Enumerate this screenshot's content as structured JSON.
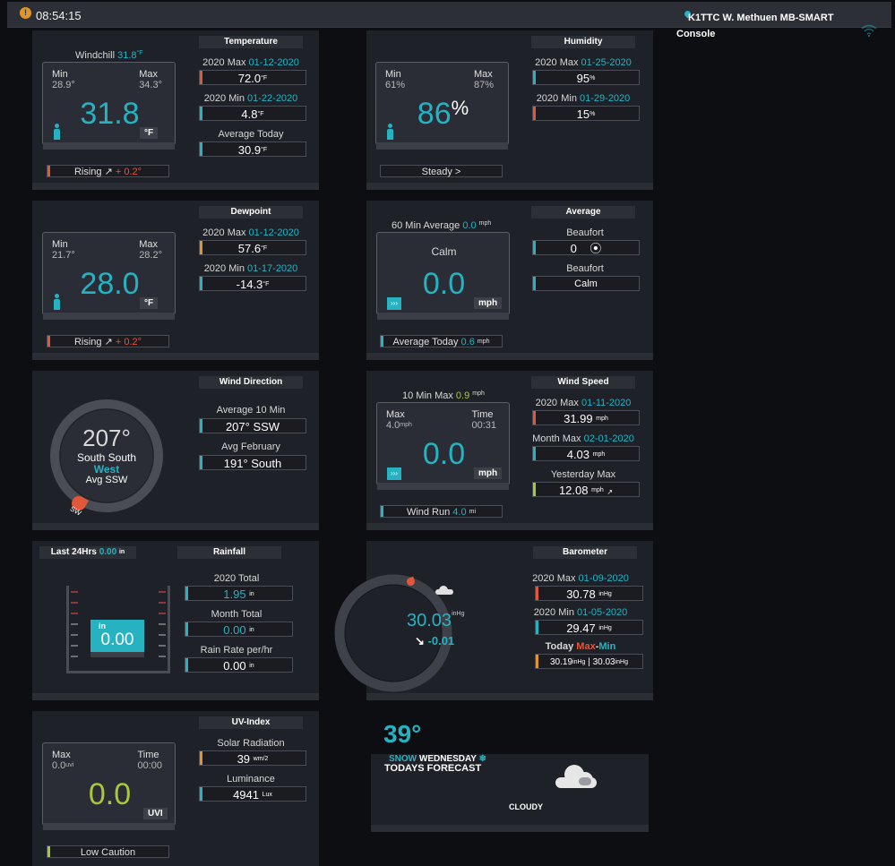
{
  "header": {
    "time": "08:54:15",
    "station": "K1TTC W. Methuen MB-SMART",
    "console": "Console"
  },
  "colors": {
    "accent": "#27b2c2",
    "hot": "#e2563a",
    "warm": "#e0952a",
    "lime": "#a6c83a",
    "panel": "#1f2128"
  },
  "temperature": {
    "title": "Temperature",
    "windchill_label": "Windchill",
    "windchill_value": "31.8",
    "windchill_unit": "°F",
    "min_label": "Min",
    "min_value": "28.9°",
    "max_label": "Max",
    "max_value": "34.3°",
    "current": "31.8",
    "unit": "°F",
    "trend_text": "Rising",
    "trend_delta": "+ 0.2°",
    "year_max_label": "2020 Max",
    "year_max_date": "01-12-2020",
    "year_max_value": "72.0",
    "year_max_unit": "°F",
    "year_min_label": "2020 Min",
    "year_min_date": "01-22-2020",
    "year_min_value": "4.8",
    "year_min_unit": "°F",
    "avg_label": "Average Today",
    "avg_value": "30.9",
    "avg_unit": "°F"
  },
  "humidity": {
    "title": "Humidity",
    "min_label": "Min",
    "min_value": "61%",
    "max_label": "Max",
    "max_value": "87%",
    "current": "86",
    "unit": "%",
    "trend_text": "Steady >",
    "year_max_label": "2020 Max",
    "year_max_date": "01-25-2020",
    "year_max_value": "95",
    "year_max_unit": "%",
    "year_min_label": "2020 Min",
    "year_min_date": "01-29-2020",
    "year_min_value": "15",
    "year_min_unit": "%"
  },
  "dewpoint": {
    "title": "Dewpoint",
    "min_label": "Min",
    "min_value": "21.7°",
    "max_label": "Max",
    "max_value": "28.2°",
    "current": "28.0",
    "unit": "°F",
    "trend_text": "Rising",
    "trend_delta": "+ 0.2°",
    "year_max_label": "2020 Max",
    "year_max_date": "01-12-2020",
    "year_max_value": "57.6",
    "year_max_unit": "°F",
    "year_min_label": "2020 Min",
    "year_min_date": "01-17-2020",
    "year_min_value": "-14.3",
    "year_min_unit": "°F"
  },
  "wind_average": {
    "title": "Average",
    "avg60_label": "60 Min Average",
    "avg60_value": "0.0",
    "avg60_unit": "mph",
    "condition": "Calm",
    "current": "0.0",
    "unit": "mph",
    "avg_today_label": "Average Today",
    "avg_today_value": "0.6",
    "avg_today_unit": "mph",
    "beaufort_label": "Beaufort",
    "beaufort_value": "0",
    "beaufort2_label": "Beaufort",
    "beaufort2_value": "Calm"
  },
  "wind_direction": {
    "title": "Wind Direction",
    "degrees": "207°",
    "line1": "South South",
    "line2": "West",
    "line3": "Avg SSW",
    "marker": "SW",
    "avg10_label": "Average 10 Min",
    "avg10_value": "207°  SSW",
    "avg_month_label": "Avg February",
    "avg_month_value": "191°  South"
  },
  "wind_speed": {
    "title": "Wind Speed",
    "max10_label": "10 Min Max",
    "max10_value": "0.9",
    "max10_unit": "mph",
    "max_label": "Max",
    "max_value": "4.0",
    "max_unit": "mph",
    "time_label": "Time",
    "time_value": "00:31",
    "current": "0.0",
    "unit": "mph",
    "windrun_label": "Wind Run",
    "windrun_value": "4.0",
    "windrun_unit": "mi",
    "year_max_label": "2020 Max",
    "year_max_date": "01-11-2020",
    "year_max_value": "31.99",
    "year_max_unit": "mph",
    "month_max_label": "Month Max",
    "month_max_date": "02-01-2020",
    "month_max_value": "4.03",
    "month_max_unit": "mph",
    "yesterday_label": "Yesterday Max",
    "yesterday_value": "12.08",
    "yesterday_unit": "mph"
  },
  "rainfall": {
    "title": "Rainfall",
    "last24_label": "Last 24Hrs",
    "last24_value": "0.00",
    "last24_unit": "in",
    "gauge_unit": "in",
    "gauge_value": "0.00",
    "year_label": "2020 Total",
    "year_value": "1.95",
    "year_unit": "in",
    "month_label": "Month Total",
    "month_value": "0.00",
    "month_unit": "in",
    "rate_label": "Rain Rate per/hr",
    "rate_value": "0.00",
    "rate_unit": "in"
  },
  "barometer": {
    "title": "Barometer",
    "current": "30.03",
    "unit": "inHg",
    "trend": "-0.01",
    "year_max_label": "2020 Max",
    "year_max_date": "01-09-2020",
    "year_max_value": "30.78",
    "year_max_unit": "inHg",
    "year_min_label": "2020 Min",
    "year_min_date": "01-05-2020",
    "year_min_value": "29.47",
    "year_min_unit": "inHg",
    "today_label": "Today",
    "today_max_word": "Max",
    "today_min_word": "Min",
    "today_max_value": "30.19",
    "today_min_value": "30.03",
    "today_unit": "inHg"
  },
  "uv": {
    "title": "UV-Index",
    "max_label": "Max",
    "max_value": "0.0",
    "max_unit": "uvi",
    "time_label": "Time",
    "time_value": "00:00",
    "current": "0.0",
    "unit": "UVI",
    "caution": "Low Caution",
    "solar_label": "Solar Radiation",
    "solar_value": "39",
    "solar_unit": "wm/2",
    "lum_label": "Luminance",
    "lum_value": "4941",
    "lum_unit": "Lux"
  },
  "forecast": {
    "temp": "39°",
    "snow": "SNOW",
    "day": "WEDNESDAY",
    "label": "TODAYS FORECAST",
    "condition": "CLOUDY"
  }
}
